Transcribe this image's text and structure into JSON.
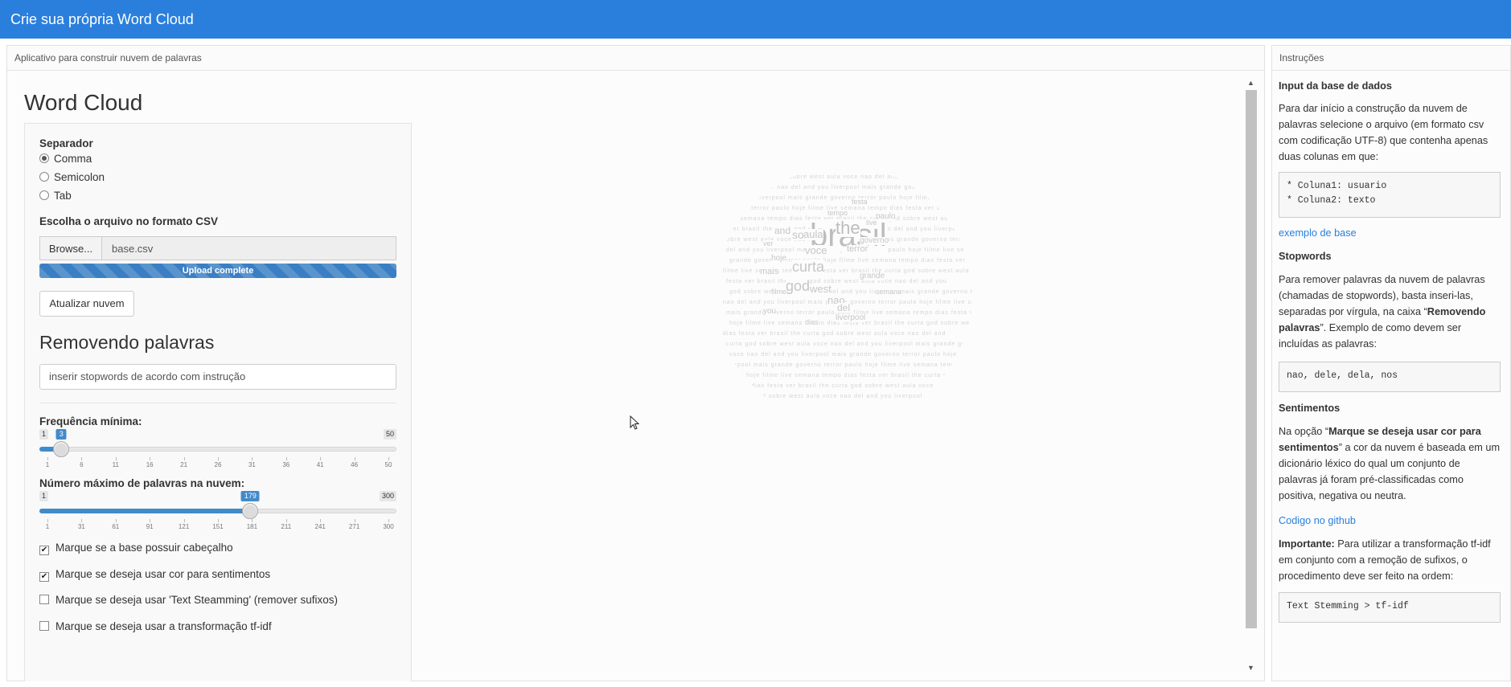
{
  "header": {
    "title": "Crie sua própria Word Cloud"
  },
  "main": {
    "panel_title": "Aplicativo para construir nuvem de palavras",
    "heading": "Word Cloud",
    "separator": {
      "label": "Separador",
      "options": [
        "Comma",
        "Semicolon",
        "Tab"
      ],
      "selected": "Comma"
    },
    "file": {
      "label": "Escolha o arquivo no formato CSV",
      "browse": "Browse...",
      "filename": "base.csv",
      "progress_text": "Upload complete",
      "progress": 1.0
    },
    "update_button": "Atualizar nuvem",
    "remove_heading": "Removendo palavras",
    "stopwords_placeholder": "inserir stopwords de acordo com instrução",
    "slider_freq": {
      "label": "Frequência mínima:",
      "min": 1,
      "max": 50,
      "value": 3,
      "min_text": "1",
      "max_text": "50",
      "value_text": "3",
      "ticks": [
        "1",
        "6",
        "11",
        "16",
        "21",
        "26",
        "31",
        "36",
        "41",
        "46",
        "50"
      ]
    },
    "slider_max": {
      "label": "Número máximo de palavras na nuvem:",
      "min": 1,
      "max": 300,
      "value": 179,
      "min_text": "1",
      "max_text": "300",
      "value_text": "179",
      "ticks": [
        "1",
        "31",
        "61",
        "91",
        "121",
        "151",
        "181",
        "211",
        "241",
        "271",
        "300"
      ]
    },
    "checkboxes": [
      {
        "label": "Marque se a base possuir cabeçalho",
        "checked": true
      },
      {
        "label": "Marque se deseja usar cor para sentimentos",
        "checked": true
      },
      {
        "label": "Marque se deseja usar 'Text Steamming' (remover sufixos)",
        "checked": false
      },
      {
        "label": "Marque se deseja usar a transformação tf-idf",
        "checked": false
      }
    ],
    "cloud_words": [
      "brasil",
      "the",
      "curta",
      "god",
      "sobre",
      "west",
      "aula",
      "voce",
      "nao",
      "del",
      "and",
      "you",
      "liverpool",
      "mais",
      "grande",
      "governo",
      "terror",
      "paulo",
      "hoje",
      "filme",
      "live",
      "semana",
      "tempo",
      "dias",
      "festa",
      "ver"
    ]
  },
  "instructions": {
    "title": "Instruções",
    "input_heading": "Input da base de dados",
    "input_text": "Para dar início a construção da nuvem de palavras selecione o arquivo (em formato csv com codificação UTF-8) que contenha apenas duas colunas em que:",
    "code1": "* Coluna1: usuario\n* Coluna2: texto",
    "example_link": "exemplo de base",
    "stop_heading": "Stopwords",
    "stop_text_1": "Para remover palavras da nuvem de palavras (chamadas de stopwords), basta inseri-las, separadas por vírgula, na caixa “",
    "stop_text_bold": "Removendo palavras",
    "stop_text_2": "”. Exemplo de como devem ser incluídas as palavras:",
    "code2": "nao, dele, dela, nos",
    "sent_heading": "Sentimentos",
    "sent_text_1": "Na opção “",
    "sent_text_bold": "Marque se deseja usar cor para sentimentos",
    "sent_text_2": "” a cor da nuvem é baseada em um dicionário léxico do qual um conjunto de palavras já foram pré-classificadas como positiva, negativa ou neutra.",
    "github_link": "Codigo no github",
    "imp_bold": "Importante:",
    "imp_text": " Para utilizar a transformação tf-idf em conjunto com a remoção de sufixos, o procedimento deve ser feito na ordem:",
    "code3": "Text Stemming > tf-idf"
  }
}
